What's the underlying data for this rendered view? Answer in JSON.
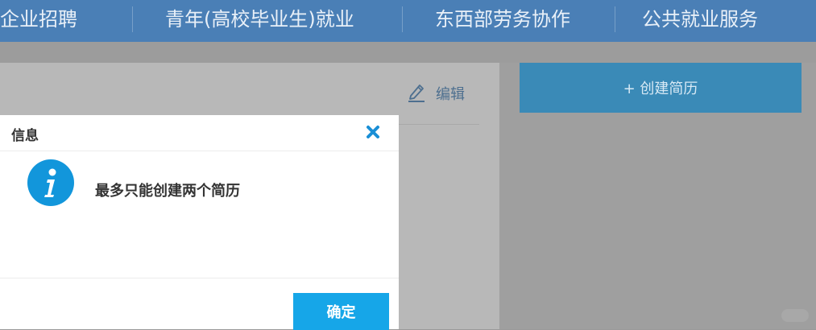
{
  "topnav": {
    "items": [
      "企业招聘",
      "青年(高校毕业生)就业",
      "东西部劳务协作",
      "公共就业服务"
    ]
  },
  "resume_card": {
    "edit_label": "编辑",
    "edit_icon": "pencil-icon"
  },
  "create_resume": {
    "label": "+ 创建简历"
  },
  "dialog": {
    "title": "信息",
    "message": "最多只能创建两个简历",
    "ok_label": "确定",
    "close_icon": "close-icon",
    "info_icon": "info-icon",
    "accent_color": "#16a6e8"
  },
  "colors": {
    "nav_bg": "#4a7fb6",
    "create_btn": "#3a8ab7",
    "ok_btn": "#16a6e8"
  }
}
